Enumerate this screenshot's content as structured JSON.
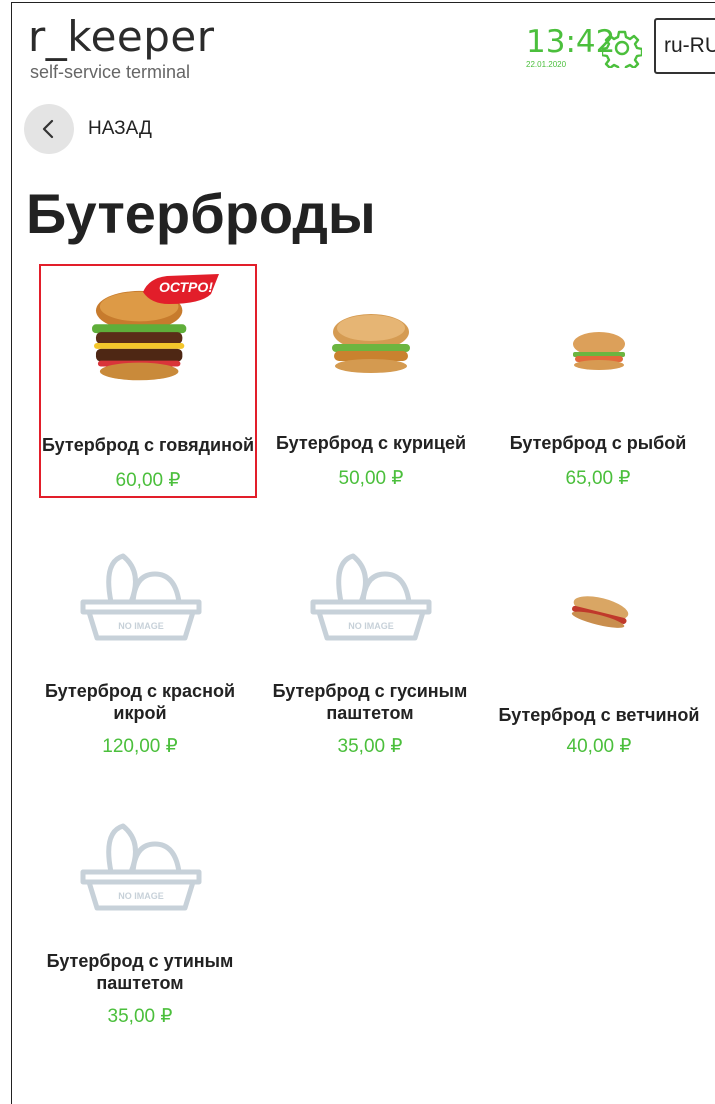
{
  "header": {
    "logo": "r_keeper",
    "logo_subtitle": "self-service terminal",
    "time": "13:42",
    "date": "22.01.2020",
    "language": "ru-RU",
    "settings_icon": "gear-icon"
  },
  "nav": {
    "back_label": "НАЗАД",
    "back_icon": "chevron-left-icon"
  },
  "page": {
    "title": "Бутерброды"
  },
  "products": [
    {
      "name": "Бутерброд с говядиной",
      "price": "60,00 ₽",
      "badge": "ОСТРО!",
      "image": "beef-burger",
      "selected": true
    },
    {
      "name": "Бутерброд с курицей",
      "price": "50,00 ₽",
      "image": "chicken-burger"
    },
    {
      "name": "Бутерброд с рыбой",
      "price": "65,00 ₽",
      "image": "fish-burger"
    },
    {
      "name": "Бутерброд с красной икрой",
      "price": "120,00 ₽",
      "image": "no-image",
      "placeholder_text": "NO IMAGE"
    },
    {
      "name": "Бутерброд с гусиным паштетом",
      "price": "35,00 ₽",
      "image": "no-image",
      "placeholder_text": "NO IMAGE"
    },
    {
      "name": "Бутерброд с ветчиной",
      "price": "40,00 ₽",
      "image": "panini"
    },
    {
      "name": "Бутерброд с утиным паштетом",
      "price": "35,00 ₽",
      "image": "no-image",
      "placeholder_text": "NO IMAGE"
    }
  ],
  "colors": {
    "accent": "#4bbf3c",
    "selected_border": "#e21e2a",
    "badge": "#e21e2a",
    "placeholder": "#c7d1d9"
  }
}
